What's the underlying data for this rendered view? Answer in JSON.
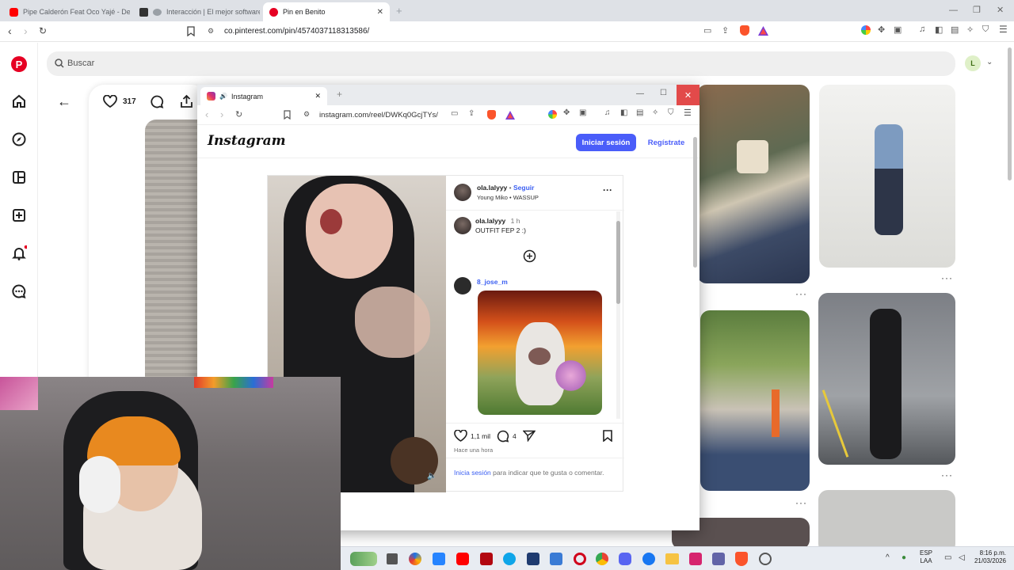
{
  "browser": {
    "tabs": [
      {
        "title": "Pipe Calderón Feat Oco Yajé - De Re...",
        "favicon": "youtube-icon"
      },
      {
        "title": "Interacción | El mejor software p...",
        "favicon": "github-icon"
      },
      {
        "title": "Pin en Benito",
        "favicon": "pinterest-icon"
      }
    ],
    "url": "co.pinterest.com/pin/4574037118313586/",
    "profile_initial": "L"
  },
  "pinterest": {
    "search_placeholder": "Buscar",
    "like_count": "317",
    "sidebar_icons": [
      "pinterest-logo-icon",
      "home-icon",
      "explore-icon",
      "boards-icon",
      "create-icon",
      "notifications-icon",
      "messages-icon"
    ],
    "brand_color": "#e60023"
  },
  "popup": {
    "tab_title": "Instagram",
    "url": "instagram.com/reel/DWKq0GcjTYs/",
    "logo": "Instagram",
    "login_label": "Iniciar sesión",
    "register_label": "Regístrate",
    "post": {
      "username": "ola.lalyyy",
      "separator": " • ",
      "follow_label": "Seguir",
      "audio": "Young Miko • WASSUP",
      "caption_user": "ola.lalyyy",
      "caption_time": "1 h",
      "caption_text": "OUTFIT FEP 2 :)",
      "commenter": "8_jose_m",
      "likes": "1,1 mil",
      "comments": "4",
      "timestamp": "Hace una hora",
      "login_prompt_link": "Inicia sesión",
      "login_prompt_rest": " para indicar que te gusta o comentar."
    },
    "accent_color": "#4a5df9"
  },
  "taskbar": {
    "lang": "ESP",
    "lang_sub": "LAA",
    "time": "8:16 p.m.",
    "date": "21/03/2026"
  }
}
